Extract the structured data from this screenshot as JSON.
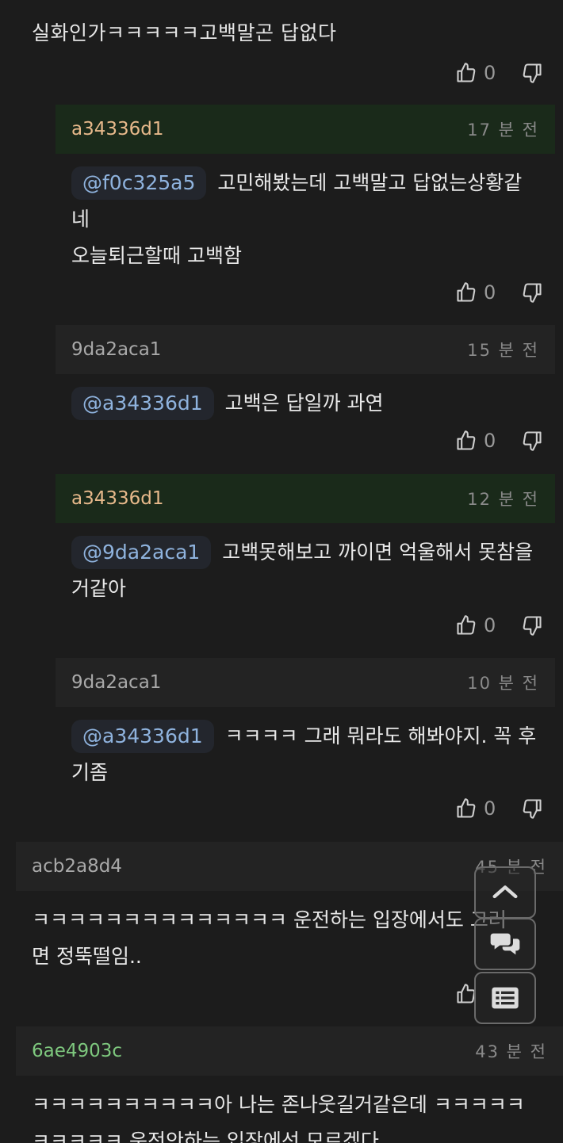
{
  "top_comment": {
    "text": "실화인가ㅋㅋㅋㅋㅋ고백말곤 답없다",
    "likes": "0"
  },
  "replies": [
    {
      "author": "a34336d1",
      "time": "17 분 전",
      "mention": "@f0c325a5",
      "text_line1": "고민해봤는데 고백말고 답없는상황같",
      "text_line2": "네",
      "text_line3": "오늘퇴근할때 고백함",
      "likes": "0"
    },
    {
      "author": "9da2aca1",
      "time": "15 분 전",
      "mention": "@a34336d1",
      "text_line1": "고백은 답일까 과연",
      "likes": "0"
    },
    {
      "author": "a34336d1",
      "time": "12 분 전",
      "mention": "@9da2aca1",
      "text_line1": "고백못해보고 까이면 억울해서 못참을",
      "text_line2": "거같아",
      "likes": "0"
    },
    {
      "author": "9da2aca1",
      "time": "10 분 전",
      "mention": "@a34336d1",
      "text_line1": "ㅋㅋㅋㅋ 그래 뭐라도 해봐야지. 꼭 후",
      "text_line2": "기좀",
      "likes": "0"
    }
  ],
  "comments": [
    {
      "author": "acb2a8d4",
      "time": "45 분 전",
      "text_line1": "ㅋㅋㅋㅋㅋㅋㅋㅋㅋㅋㅋㅋㅋㅋ 운전하는 입장에서도 그러",
      "text_line2": "면 정뚝떨임.."
    },
    {
      "author": "6ae4903c",
      "time": "43 분 전",
      "text_line1": "ㅋㅋㅋㅋㅋㅋㅋㅋㅋㅋ아 나는 존나웃길거같은데 ㅋㅋㅋㅋㅋ",
      "text_line2": "ㅋㅋㅋㅋㅋ 운전안하는 입장에선 모르겠다"
    }
  ],
  "icons": {
    "like": "thumbs-up-icon",
    "dislike": "thumbs-down-icon",
    "scroll_top": "chevron-up-icon",
    "comments": "chat-bubbles-icon",
    "list": "list-icon"
  }
}
